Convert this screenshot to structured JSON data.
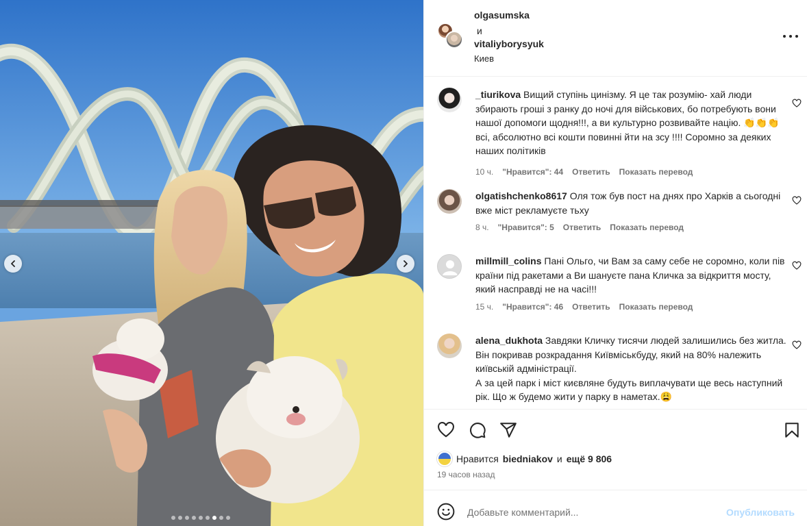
{
  "post": {
    "user1": "olgasumska",
    "and": "и",
    "user2": "vitaliyborysyuk",
    "location": "Киев"
  },
  "carousel": {
    "slide_count": 9,
    "active_index": 6
  },
  "comments": [
    {
      "username": "_tiurikova",
      "text": "Вищий ступінь цинізму. Я це так розумію- хай люди збирають гроші з ранку до ночі для військових, бо потребують вони нашої допомоги щодня!!!, а ви культурно розвивайте націю. 👏👏👏 всі, абсолютно всі кошти повинні йти на зсу !!!! Соромно за деяких наших політиків",
      "time": "10 ч.",
      "likes": "\"Нравится\": 44",
      "reply": "Ответить",
      "translate": "Показать перевод"
    },
    {
      "username": "olgatishchenko8617",
      "text": "Оля тож був пост на днях про Харків а сьогодні вже міст рекламуєте тьху",
      "time": "8 ч.",
      "likes": "\"Нравится\": 5",
      "reply": "Ответить",
      "translate": "Показать перевод"
    },
    {
      "username": "millmill_colins",
      "text": "Пані Ольго, чи Вам за саму себе не соромно, коли пів країни під ракетами а Ви шануєте пана Кличка за відкриття мосту, який насправді не на часі!!!",
      "time": "15 ч.",
      "likes": "\"Нравится\": 46",
      "reply": "Ответить",
      "translate": "Показать перевод"
    },
    {
      "username": "alena_dukhota",
      "text": "Завдяки Кличку тисячи людей залишились без житла. Він покривав розкрадання Київміськбуду, який на 80% належить київській адміністрації.\nА за цей парк і міст києвляне будуть виплачувати ще весь наступний рік. Що ж будемо жити у парку в наметах.😩",
      "time": "",
      "likes": "",
      "reply": "",
      "translate": ""
    }
  ],
  "likes_row": {
    "prefix": "Нравится",
    "user": "biedniakov",
    "middle": "и",
    "rest": "ещё 9 806"
  },
  "timestamp": "19 часов назад",
  "add_comment": {
    "placeholder": "Добавьте комментарий...",
    "publish": "Опубликовать"
  },
  "colors": {
    "text": "#262626",
    "muted": "#737373",
    "divider": "#efefef",
    "publish_disabled": "#b3dbff",
    "sky": "#3f87d6"
  },
  "icons": [
    "chevron-left-icon",
    "chevron-right-icon",
    "more-icon",
    "heart-icon",
    "comment-icon",
    "share-icon",
    "bookmark-icon",
    "emoji-icon"
  ]
}
